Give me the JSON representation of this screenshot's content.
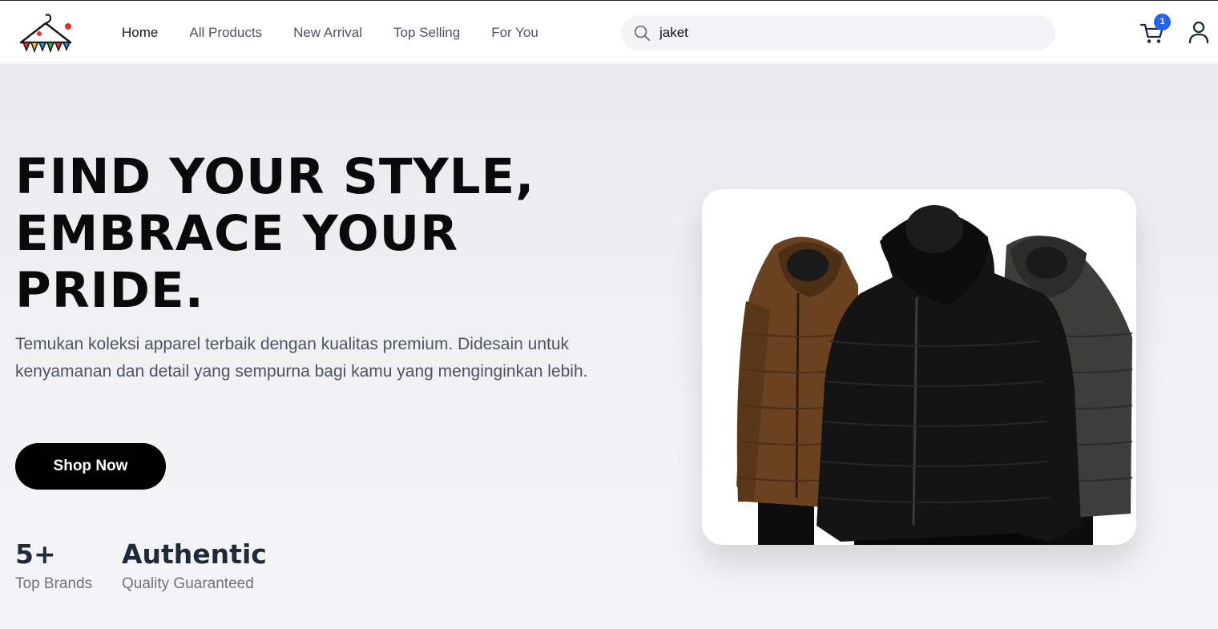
{
  "header": {
    "nav": [
      {
        "label": "Home",
        "active": true
      },
      {
        "label": "All Products",
        "active": false
      },
      {
        "label": "New Arrival",
        "active": false
      },
      {
        "label": "Top Selling",
        "active": false
      },
      {
        "label": "For You",
        "active": false
      }
    ],
    "search": {
      "value": "jaket",
      "icon": "search-icon"
    },
    "cart": {
      "count": "1",
      "icon": "cart-icon"
    },
    "user_icon": "user-icon"
  },
  "hero": {
    "headline_line1": "FIND YOUR STYLE,",
    "headline_line2": "EMBRACE YOUR",
    "headline_line3": "PRIDE.",
    "description": "Temukan koleksi apparel terbaik dengan kualitas premium. Didesain untuk kenyamanan dan detail yang sempurna bagi kamu yang menginginkan lebih.",
    "cta_label": "Shop Now",
    "stats": [
      {
        "value": "5+",
        "label": "Top Brands"
      },
      {
        "value": "Authentic",
        "label": "Quality Guaranteed"
      }
    ]
  },
  "colors": {
    "accent": "#2563eb",
    "button": "#000000",
    "jacket_brown": "#6b4220",
    "jacket_black": "#141414",
    "jacket_gray": "#3d3d3a"
  }
}
